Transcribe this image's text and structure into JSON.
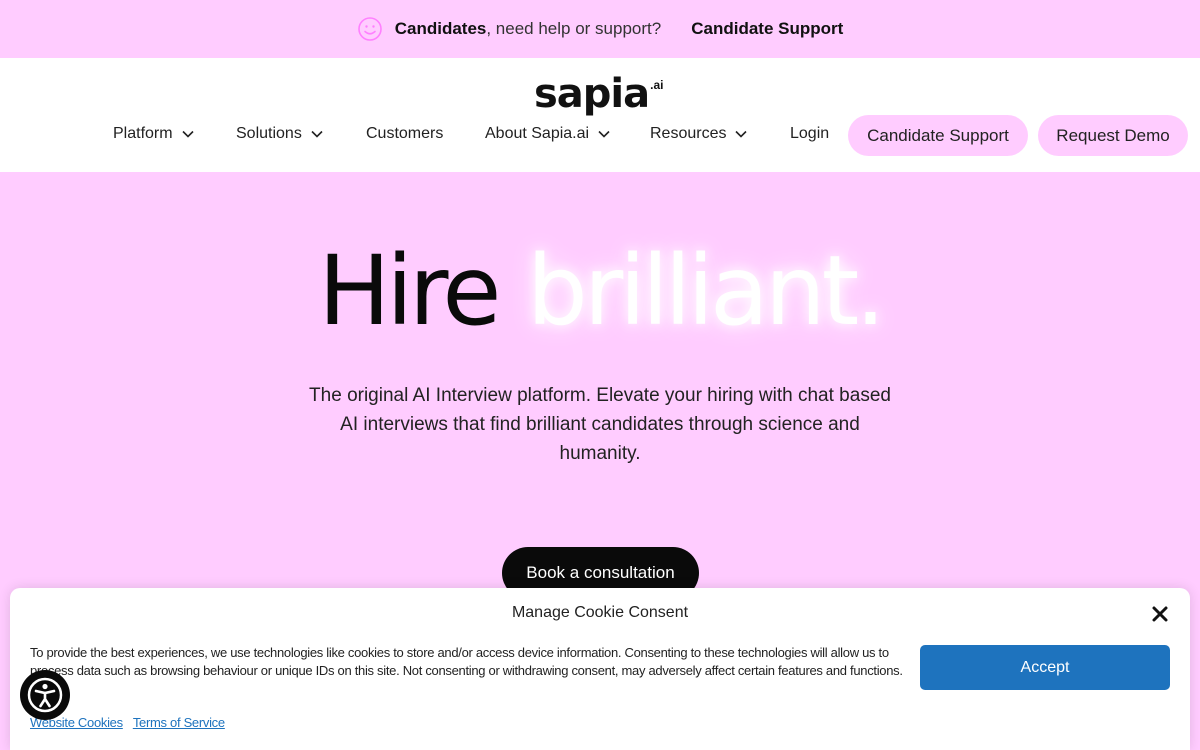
{
  "topbar": {
    "icon": "smile-icon",
    "bold_text": "Candidates",
    "rest_text": ", need help or support?",
    "link_label": "Candidate Support"
  },
  "header": {
    "logo_word": "sapia",
    "logo_suffix": ".ai",
    "nav": [
      {
        "label": "Platform",
        "has_dropdown": true
      },
      {
        "label": "Solutions",
        "has_dropdown": true
      },
      {
        "label": "Customers",
        "has_dropdown": false
      },
      {
        "label": "About Sapia.ai",
        "has_dropdown": true
      },
      {
        "label": "Resources",
        "has_dropdown": true
      },
      {
        "label": "Login",
        "has_dropdown": false
      }
    ],
    "candidate_support_label": "Candidate Support",
    "request_demo_label": "Request Demo"
  },
  "hero": {
    "title_dark": "Hire",
    "title_glow": "brilliant.",
    "subtitle": "The original AI Interview platform. Elevate your hiring with chat based AI interviews that find brilliant candidates through science and humanity.",
    "cta_label": "Book a consultation"
  },
  "cookie": {
    "title": "Manage Cookie Consent",
    "text": "To provide the best experiences, we use technologies like cookies to store and/or access device information. Consenting to these technologies will allow us to process data such as browsing behaviour or unique IDs on this site. Not consenting or withdrawing consent, may adversely affect certain features and functions.",
    "accept_label": "Accept",
    "link_cookies": "Website Cookies",
    "link_terms": "Terms of Service"
  },
  "colors": {
    "brand_pink": "#ffccff",
    "accept_blue": "#1e73be",
    "dark": "#0a0a0a"
  }
}
